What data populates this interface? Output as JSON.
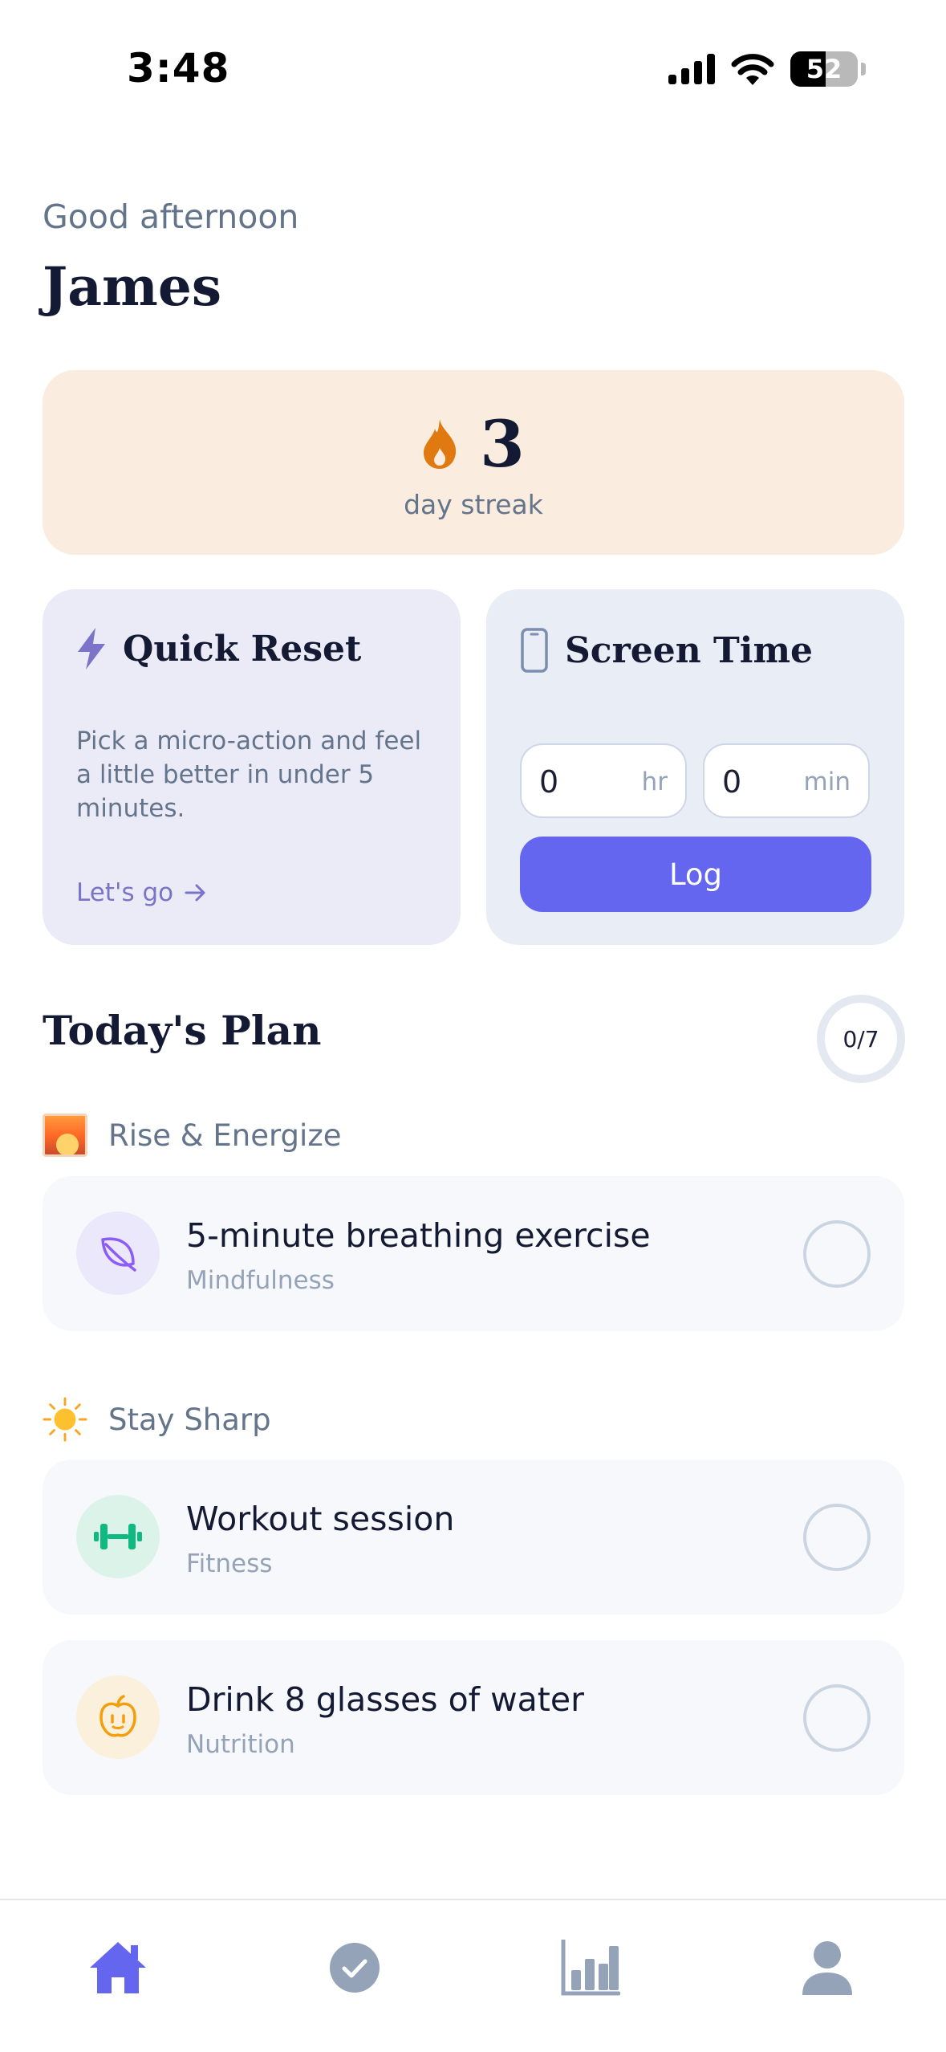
{
  "status_bar": {
    "time": "3:48",
    "battery": "52",
    "battery_level": 0.52
  },
  "greeting": "Good afternoon",
  "user_name": "James",
  "streak": {
    "count": "3",
    "label": "day streak"
  },
  "quick_reset": {
    "title": "Quick Reset",
    "description": "Pick a micro-action and feel a little better in under 5 minutes.",
    "link_label": "Let's go"
  },
  "screen_time": {
    "title": "Screen Time",
    "hours_value": "0",
    "hours_unit": "hr",
    "minutes_value": "0",
    "minutes_unit": "min",
    "log_label": "Log"
  },
  "plan": {
    "title": "Today's Plan",
    "progress": "0/7",
    "sections": [
      {
        "label": "Rise & Energize",
        "icon": "sunrise-icon",
        "tasks": [
          {
            "title": "5-minute breathing exercise",
            "category": "Mindfulness",
            "icon": "leaf-icon",
            "icon_bg": "#ece8fb",
            "icon_color": "#8b5cf6"
          }
        ]
      },
      {
        "label": "Stay Sharp",
        "icon": "sun-icon",
        "tasks": [
          {
            "title": "Workout session",
            "category": "Fitness",
            "icon": "dumbbell-icon",
            "icon_bg": "#dcf3ea",
            "icon_color": "#10b981"
          },
          {
            "title": "Drink 8 glasses of water",
            "category": "Nutrition",
            "icon": "apple-icon",
            "icon_bg": "#fbf0dc",
            "icon_color": "#f59e0b"
          }
        ]
      }
    ]
  },
  "nav": {
    "items": [
      {
        "name": "home",
        "icon": "home-icon",
        "active": true
      },
      {
        "name": "tasks",
        "icon": "check-circle-icon",
        "active": false
      },
      {
        "name": "stats",
        "icon": "bar-chart-icon",
        "active": false
      },
      {
        "name": "profile",
        "icon": "user-icon",
        "active": false
      }
    ],
    "active_color": "#6466ef",
    "inactive_color": "#94a3b8"
  }
}
